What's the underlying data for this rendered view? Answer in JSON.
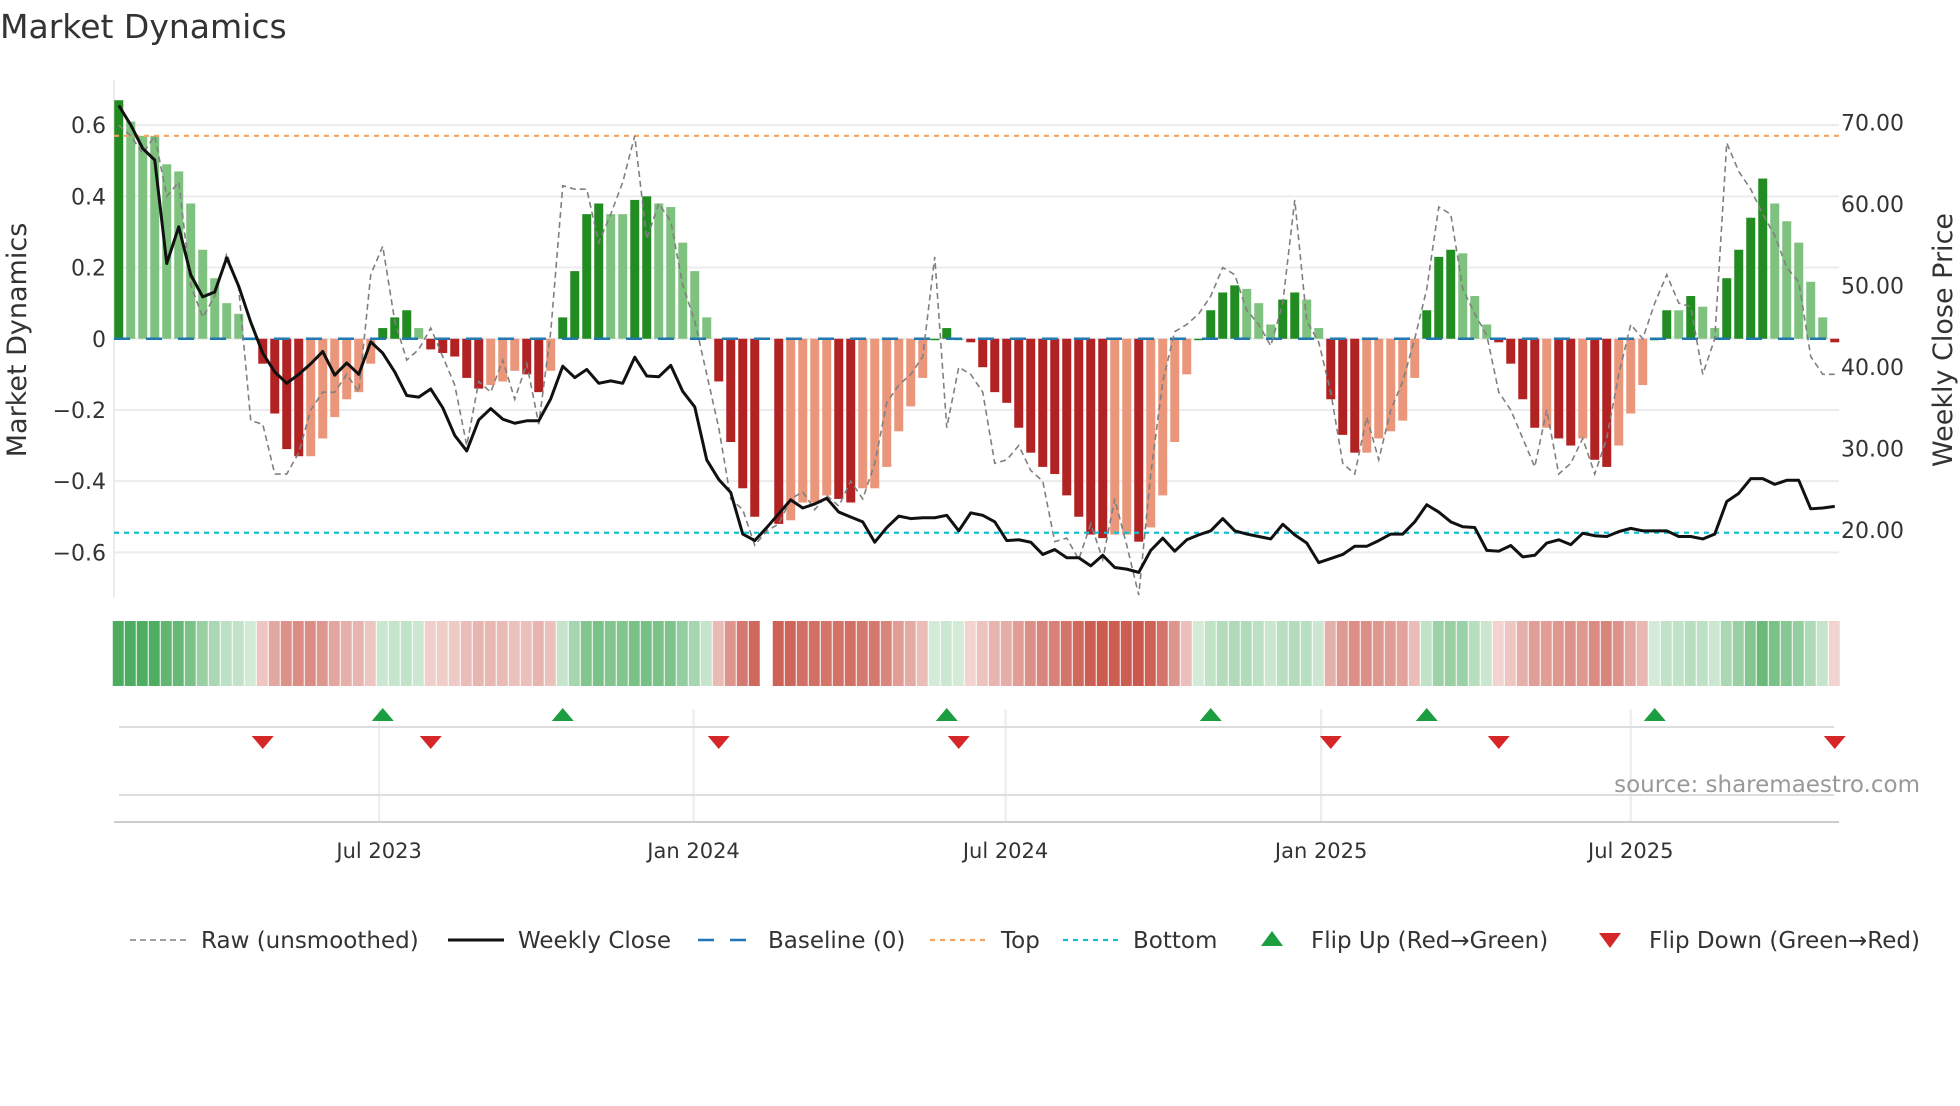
{
  "chart_data": {
    "type": "bar",
    "title": "Market Dynamics",
    "ylabel_left": "Market Dynamics",
    "ylabel_right": "Weekly Close Price",
    "ylim_left": [
      -0.72,
      0.72
    ],
    "ylim_right": [
      14.0,
      75.0
    ],
    "yticks_left": [
      {
        "value": 0.6,
        "label": "0.6"
      },
      {
        "value": 0.4,
        "label": "0.4"
      },
      {
        "value": 0.2,
        "label": "0.2"
      },
      {
        "value": 0,
        "label": "0"
      },
      {
        "value": -0.2,
        "label": "−0.2"
      },
      {
        "value": -0.4,
        "label": "−0.4"
      },
      {
        "value": -0.6,
        "label": "−0.6"
      }
    ],
    "yticks_right": [
      {
        "value": 70,
        "label": "70.00"
      },
      {
        "value": 60,
        "label": "60.00"
      },
      {
        "value": 50,
        "label": "50.00"
      },
      {
        "value": 40,
        "label": "40.00"
      },
      {
        "value": 30,
        "label": "30.00"
      },
      {
        "value": 20,
        "label": "20.00"
      }
    ],
    "xticks": [
      {
        "week": 21.7,
        "label": "Jul 2023"
      },
      {
        "week": 47.9,
        "label": "Jan 2024"
      },
      {
        "week": 73.9,
        "label": "Jul 2024"
      },
      {
        "week": 100.2,
        "label": "Jan 2025"
      },
      {
        "week": 126.0,
        "label": "Jul 2025"
      }
    ],
    "top_threshold": 0.57,
    "bottom_threshold": -0.545,
    "smoothed": [
      0.67,
      0.61,
      0.57,
      0.57,
      0.49,
      0.47,
      0.38,
      0.25,
      0.17,
      0.1,
      0.07,
      0.0,
      -0.07,
      -0.21,
      -0.31,
      -0.33,
      -0.33,
      -0.28,
      -0.22,
      -0.17,
      -0.15,
      -0.07,
      0.03,
      0.06,
      0.08,
      0.03,
      -0.03,
      -0.04,
      -0.05,
      -0.11,
      -0.14,
      -0.13,
      -0.12,
      -0.09,
      -0.1,
      -0.15,
      -0.09,
      0.06,
      0.19,
      0.35,
      0.38,
      0.35,
      0.35,
      0.39,
      0.4,
      0.38,
      0.37,
      0.27,
      0.19,
      0.06,
      -0.12,
      -0.29,
      -0.42,
      -0.5,
      null,
      -0.52,
      -0.51,
      -0.46,
      -0.46,
      -0.44,
      -0.45,
      -0.46,
      -0.42,
      -0.42,
      -0.36,
      -0.26,
      -0.19,
      -0.11,
      0.0,
      0.03,
      0.0,
      -0.01,
      -0.08,
      -0.15,
      -0.18,
      -0.25,
      -0.32,
      -0.36,
      -0.38,
      -0.44,
      -0.5,
      -0.55,
      -0.56,
      -0.55,
      -0.55,
      -0.57,
      -0.53,
      -0.44,
      -0.29,
      -0.1,
      0.0,
      0.08,
      0.13,
      0.15,
      0.14,
      0.1,
      0.04,
      0.11,
      0.13,
      0.11,
      0.03,
      -0.17,
      -0.27,
      -0.32,
      -0.32,
      -0.28,
      -0.26,
      -0.23,
      -0.11,
      0.08,
      0.23,
      0.25,
      0.24,
      0.12,
      0.04,
      -0.01,
      -0.07,
      -0.17,
      -0.25,
      -0.25,
      -0.28,
      -0.3,
      -0.28,
      -0.34,
      -0.36,
      -0.3,
      -0.21,
      -0.13,
      0.0,
      0.08,
      0.08,
      0.12,
      0.09,
      0.03,
      0.17,
      0.25,
      0.34,
      0.45,
      0.38,
      0.33,
      0.27,
      0.16,
      0.06,
      -0.01
    ],
    "raw": [
      0.6,
      0.57,
      0.52,
      0.57,
      0.4,
      0.44,
      0.15,
      0.06,
      0.12,
      0.24,
      0.14,
      -0.23,
      -0.24,
      -0.38,
      -0.38,
      -0.32,
      -0.2,
      -0.15,
      -0.15,
      -0.1,
      -0.15,
      0.18,
      0.26,
      0.05,
      -0.06,
      -0.03,
      0.03,
      -0.05,
      -0.13,
      -0.3,
      -0.12,
      -0.15,
      -0.06,
      -0.17,
      -0.07,
      -0.24,
      0.02,
      0.43,
      0.42,
      0.42,
      0.27,
      0.35,
      0.44,
      0.57,
      0.28,
      0.38,
      0.33,
      0.15,
      0.05,
      -0.1,
      -0.25,
      -0.45,
      -0.48,
      -0.58,
      -0.54,
      -0.52,
      -0.45,
      -0.43,
      -0.48,
      -0.44,
      -0.47,
      -0.4,
      -0.45,
      -0.35,
      -0.18,
      -0.13,
      -0.1,
      -0.05,
      0.23,
      -0.25,
      -0.08,
      -0.1,
      -0.15,
      -0.35,
      -0.34,
      -0.3,
      -0.37,
      -0.4,
      -0.57,
      -0.56,
      -0.62,
      -0.52,
      -0.62,
      -0.45,
      -0.58,
      -0.72,
      -0.38,
      -0.12,
      0.02,
      0.04,
      0.07,
      0.12,
      0.2,
      0.18,
      0.08,
      0.04,
      -0.02,
      0.1,
      0.39,
      0.05,
      -0.01,
      -0.15,
      -0.35,
      -0.38,
      -0.22,
      -0.34,
      -0.2,
      -0.12,
      0.0,
      0.14,
      0.37,
      0.35,
      0.14,
      0.07,
      0.01,
      -0.15,
      -0.2,
      -0.28,
      -0.36,
      -0.2,
      -0.38,
      -0.35,
      -0.28,
      -0.38,
      -0.28,
      -0.1,
      0.04,
      0.0,
      0.1,
      0.18,
      0.1,
      0.09,
      -0.1,
      0.0,
      0.55,
      0.47,
      0.42,
      0.35,
      0.29,
      0.2,
      0.16,
      -0.05,
      -0.1,
      -0.1
    ],
    "close": [
      72.1,
      69.7,
      66.8,
      65.4,
      52.7,
      57.2,
      51.3,
      48.6,
      49.2,
      53.4,
      49.9,
      45.5,
      41.7,
      39.4,
      38.0,
      39.1,
      40.4,
      41.9,
      39.0,
      40.5,
      39.1,
      43.1,
      41.7,
      39.4,
      36.5,
      36.3,
      37.3,
      35.0,
      31.6,
      29.7,
      33.5,
      34.9,
      33.6,
      33.1,
      33.4,
      33.4,
      36.1,
      40.1,
      38.7,
      39.7,
      38.0,
      38.3,
      38.0,
      41.2,
      38.9,
      38.8,
      40.2,
      37.0,
      35.1,
      28.6,
      26.2,
      24.6,
      19.5,
      18.7,
      20.3,
      22.0,
      23.7,
      22.7,
      23.2,
      23.9,
      22.2,
      21.6,
      21.0,
      18.5,
      20.3,
      21.7,
      21.4,
      21.5,
      21.5,
      21.8,
      19.9,
      22.1,
      21.8,
      21.0,
      18.7,
      18.8,
      18.5,
      17.0,
      17.6,
      16.6,
      16.6,
      15.6,
      16.9,
      15.4,
      15.2,
      14.8,
      17.5,
      19.0,
      17.4,
      18.8,
      19.4,
      19.9,
      21.4,
      19.9,
      19.5,
      19.2,
      18.9,
      20.7,
      19.4,
      18.4,
      16.0,
      16.5,
      17.0,
      18.0,
      18.0,
      18.7,
      19.5,
      19.5,
      21.0,
      23.1,
      22.2,
      21.0,
      20.4,
      20.3,
      17.5,
      17.4,
      18.1,
      16.7,
      16.9,
      18.4,
      18.8,
      18.2,
      19.6,
      19.3,
      19.2,
      19.8,
      20.2,
      19.9,
      19.9,
      19.9,
      19.2,
      19.2,
      18.9,
      19.5,
      23.5,
      24.5,
      26.3,
      26.3,
      25.6,
      26.1,
      26.1,
      22.6,
      22.7,
      22.9
    ],
    "flip_up_weeks": [
      22,
      37,
      69,
      91,
      109,
      128
    ],
    "flip_down_weeks": [
      12,
      26,
      50,
      70,
      101,
      115,
      143
    ],
    "colors": {
      "pos_rising": "#228b22",
      "pos_falling": "#7fc17f",
      "neg_falling": "#b22222",
      "neg_rising": "#e9967a",
      "raw": "#808080",
      "close": "#111111",
      "baseline": "#1f77b4",
      "top": "#f4a460",
      "bottom": "#17becf",
      "flip_up": "#1a9e3f",
      "flip_down": "#d62728"
    },
    "legend": [
      {
        "key": "raw",
        "label": "Raw (unsmoothed)"
      },
      {
        "key": "close",
        "label": "Weekly Close"
      },
      {
        "key": "baseline",
        "label": "Baseline (0)"
      },
      {
        "key": "top",
        "label": "Top"
      },
      {
        "key": "bottom",
        "label": "Bottom"
      },
      {
        "key": "flip_up",
        "label": "Flip Up (Red→Green)"
      },
      {
        "key": "flip_down",
        "label": "Flip Down (Green→Red)"
      }
    ],
    "legend_position": "bottom",
    "source": "source: sharemaestro.com"
  }
}
